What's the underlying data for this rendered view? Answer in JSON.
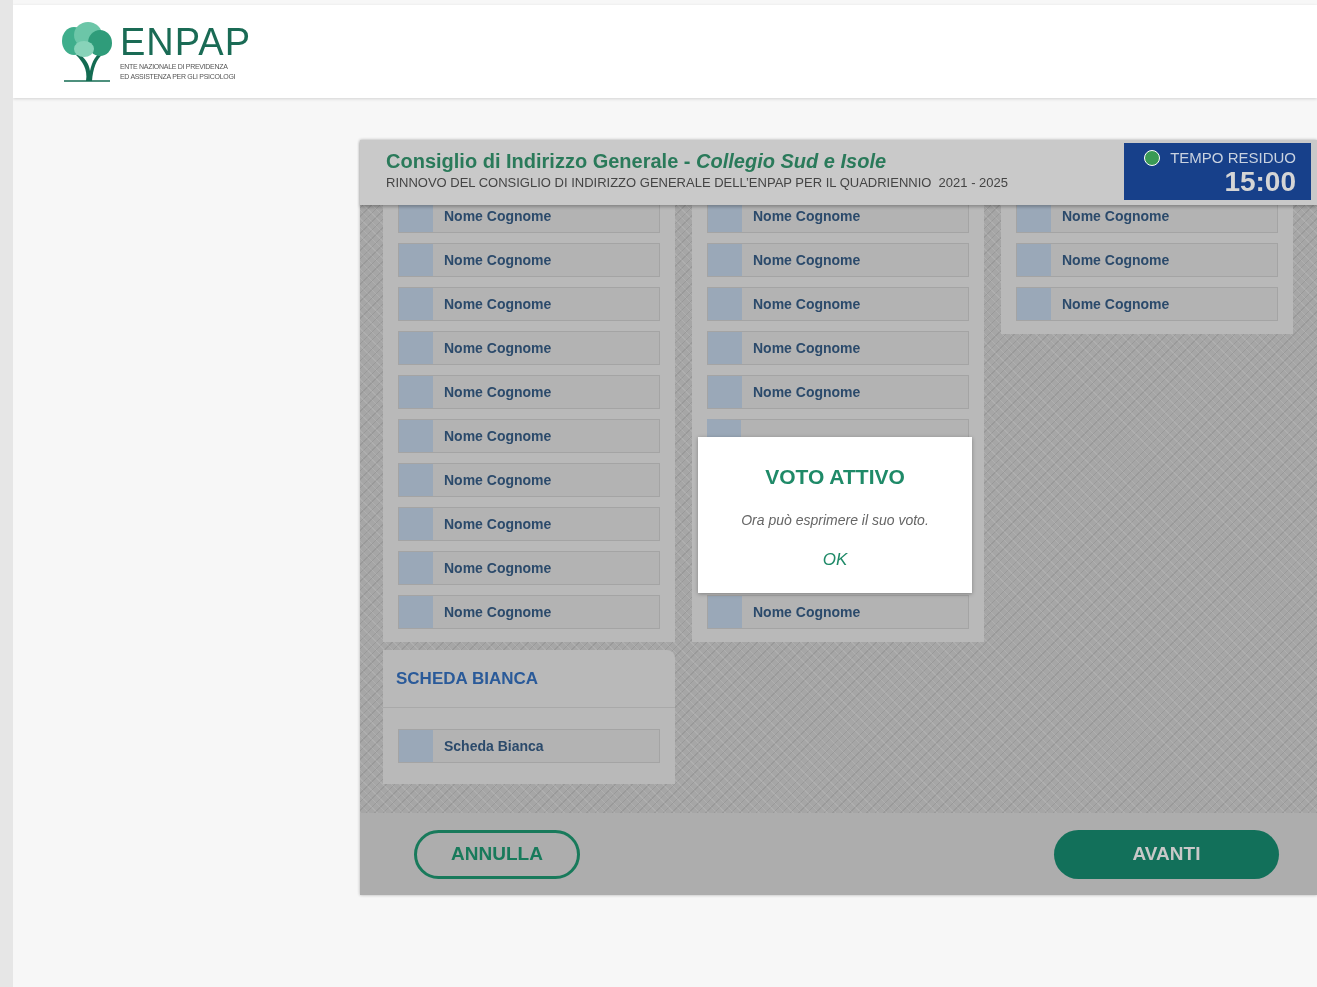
{
  "logo": {
    "name": "ENPAP",
    "subtitle_lines": [
      "ENTE NAZIONALE DI PREVIDENZA",
      "ED ASSISTENZA PER GLI PSICOLOGI"
    ]
  },
  "ballot": {
    "title": "Consiglio di Indirizzo Generale - ",
    "title_italic": "Collegio Sud e Isole",
    "subtitle": "RINNOVO DEL CONSIGLIO DI INDIRIZZO GENERALE DELL’ENPAP PER IL QUADRIENNIO  2021 - 2025",
    "timer": {
      "label": "TEMPO RESIDUO",
      "value": "15:00",
      "active": true
    },
    "columns": [
      {
        "rows": [
          {
            "kind": "candidate",
            "text": "Nome Cognome",
            "checked": false
          },
          {
            "kind": "candidate",
            "text": "Nome Cognome",
            "checked": false
          },
          {
            "kind": "candidate",
            "text": "Nome Cognome",
            "checked": false
          },
          {
            "kind": "candidate",
            "text": "Nome Cognome",
            "checked": false
          },
          {
            "kind": "candidate",
            "text": "Nome Cognome",
            "checked": false
          },
          {
            "kind": "candidate",
            "text": "Nome Cognome",
            "checked": false
          },
          {
            "kind": "candidate",
            "text": "Nome Cognome",
            "checked": false
          },
          {
            "kind": "candidate",
            "text": "Nome Cognome",
            "checked": false
          },
          {
            "kind": "candidate",
            "text": "Nome Cognome",
            "checked": false
          },
          {
            "kind": "candidate",
            "text": "Nome Cognome",
            "checked": false
          }
        ]
      },
      {
        "rows": [
          {
            "kind": "candidate",
            "text": "Nome Cognome",
            "checked": false
          },
          {
            "kind": "candidate",
            "text": "Nome Cognome",
            "checked": false
          },
          {
            "kind": "candidate",
            "text": "Nome Cognome",
            "checked": false
          },
          {
            "kind": "candidate",
            "text": "Nome Cognome",
            "checked": false
          },
          {
            "kind": "candidate",
            "text": "Nome Cognome",
            "checked": false
          },
          {
            "kind": "covered"
          },
          {
            "kind": "hidden"
          },
          {
            "kind": "hidden"
          },
          {
            "kind": "hidden"
          },
          {
            "kind": "candidate",
            "text": "Nome Cognome",
            "checked": false
          }
        ]
      },
      {
        "rows": [
          {
            "kind": "candidate",
            "text": "Nome Cognome",
            "checked": false
          },
          {
            "kind": "candidate",
            "text": "Nome Cognome",
            "checked": false
          },
          {
            "kind": "candidate",
            "text": "Nome Cognome",
            "checked": false
          }
        ]
      }
    ],
    "blank_section": {
      "heading": "SCHEDA BIANCA",
      "option": {
        "kind": "candidate",
        "text": "Scheda Bianca",
        "checked": false
      }
    },
    "buttons": {
      "cancel": "ANNULLA",
      "next": "AVANTI"
    }
  },
  "dialog": {
    "title": "VOTO ATTIVO",
    "message": "Ora può esprimere il suo voto.",
    "ok": "OK"
  }
}
